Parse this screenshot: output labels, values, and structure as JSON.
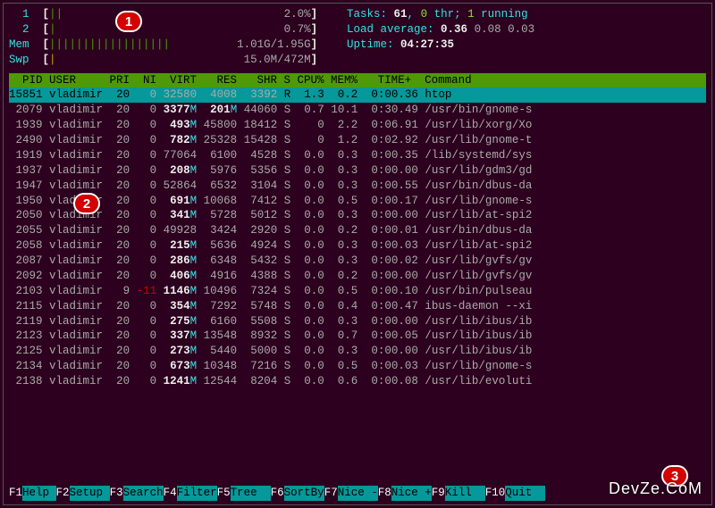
{
  "cpu_bars": [
    {
      "id": "1",
      "used": "||",
      "pct": "2.0%"
    },
    {
      "id": "2",
      "used": "|",
      "pct": "0.7%"
    }
  ],
  "mem": {
    "label": "Mem",
    "bars": "||||||||||||||||||",
    "text": "1.01G/1.95G"
  },
  "swp": {
    "label": "Swp",
    "bars": "|",
    "text": "15.0M/472M"
  },
  "tasks": {
    "label": "Tasks:",
    "total": "61",
    "thr": "0",
    "thr_suffix": "thr;",
    "running": "1",
    "running_suffix": "running"
  },
  "load": {
    "label": "Load average:",
    "v1": "0.36",
    "v2": "0.08",
    "v3": "0.03"
  },
  "uptime": {
    "label": "Uptime:",
    "value": "04:27:35"
  },
  "columns": "  PID USER     PRI  NI  VIRT   RES   SHR S CPU% MEM%   TIME+  Command           ",
  "processes": [
    {
      "pid": "15851",
      "user": "vladimir",
      "pri": "20",
      "ni": "0",
      "virt": "32580",
      "res": "4008",
      "shr": "3392",
      "s": "R",
      "cpu": "1.3",
      "mem": "0.2",
      "time": "0:00.36",
      "cmd": "htop",
      "hl": true
    },
    {
      "pid": "2079",
      "user": "vladimir",
      "pri": "20",
      "ni": "0",
      "virt": "3377M",
      "res": "201M",
      "shr": "44060",
      "s": "S",
      "cpu": "0.7",
      "mem": "10.1",
      "time": "0:30.49",
      "cmd": "/usr/bin/gnome-s"
    },
    {
      "pid": "1939",
      "user": "vladimir",
      "pri": "20",
      "ni": "0",
      "virt": "493M",
      "res": "45800",
      "shr": "18412",
      "s": "S",
      "cpu": "0",
      "mem": "2.2",
      "time": "0:06.91",
      "cmd": "/usr/lib/xorg/Xo"
    },
    {
      "pid": "2490",
      "user": "vladimir",
      "pri": "20",
      "ni": "0",
      "virt": "782M",
      "res": "25328",
      "shr": "15428",
      "s": "S",
      "cpu": "0",
      "mem": "1.2",
      "time": "0:02.92",
      "cmd": "/usr/lib/gnome-t"
    },
    {
      "pid": "1919",
      "user": "vladimir",
      "pri": "20",
      "ni": "0",
      "virt": "77064",
      "res": "6100",
      "shr": "4528",
      "s": "S",
      "cpu": "0.0",
      "mem": "0.3",
      "time": "0:00.35",
      "cmd": "/lib/systemd/sys"
    },
    {
      "pid": "1937",
      "user": "vladimir",
      "pri": "20",
      "ni": "0",
      "virt": "208M",
      "res": "5976",
      "shr": "5356",
      "s": "S",
      "cpu": "0.0",
      "mem": "0.3",
      "time": "0:00.00",
      "cmd": "/usr/lib/gdm3/gd"
    },
    {
      "pid": "1947",
      "user": "vladimir",
      "pri": "20",
      "ni": "0",
      "virt": "52864",
      "res": "6532",
      "shr": "3104",
      "s": "S",
      "cpu": "0.0",
      "mem": "0.3",
      "time": "0:00.55",
      "cmd": "/usr/bin/dbus-da"
    },
    {
      "pid": "1950",
      "user": "vladimir",
      "pri": "20",
      "ni": "0",
      "virt": "691M",
      "res": "10068",
      "shr": "7412",
      "s": "S",
      "cpu": "0.0",
      "mem": "0.5",
      "time": "0:00.17",
      "cmd": "/usr/lib/gnome-s"
    },
    {
      "pid": "2050",
      "user": "vladimir",
      "pri": "20",
      "ni": "0",
      "virt": "341M",
      "res": "5728",
      "shr": "5012",
      "s": "S",
      "cpu": "0.0",
      "mem": "0.3",
      "time": "0:00.00",
      "cmd": "/usr/lib/at-spi2"
    },
    {
      "pid": "2055",
      "user": "vladimir",
      "pri": "20",
      "ni": "0",
      "virt": "49928",
      "res": "3424",
      "shr": "2920",
      "s": "S",
      "cpu": "0.0",
      "mem": "0.2",
      "time": "0:00.01",
      "cmd": "/usr/bin/dbus-da"
    },
    {
      "pid": "2058",
      "user": "vladimir",
      "pri": "20",
      "ni": "0",
      "virt": "215M",
      "res": "5636",
      "shr": "4924",
      "s": "S",
      "cpu": "0.0",
      "mem": "0.3",
      "time": "0:00.03",
      "cmd": "/usr/lib/at-spi2"
    },
    {
      "pid": "2087",
      "user": "vladimir",
      "pri": "20",
      "ni": "0",
      "virt": "286M",
      "res": "6348",
      "shr": "5432",
      "s": "S",
      "cpu": "0.0",
      "mem": "0.3",
      "time": "0:00.02",
      "cmd": "/usr/lib/gvfs/gv"
    },
    {
      "pid": "2092",
      "user": "vladimir",
      "pri": "20",
      "ni": "0",
      "virt": "406M",
      "res": "4916",
      "shr": "4388",
      "s": "S",
      "cpu": "0.0",
      "mem": "0.2",
      "time": "0:00.00",
      "cmd": "/usr/lib/gvfs/gv"
    },
    {
      "pid": "2103",
      "user": "vladimir",
      "pri": "9",
      "ni": "-11",
      "virt": "1146M",
      "res": "10496",
      "shr": "7324",
      "s": "S",
      "cpu": "0.0",
      "mem": "0.5",
      "time": "0:00.10",
      "cmd": "/usr/bin/pulseau"
    },
    {
      "pid": "2115",
      "user": "vladimir",
      "pri": "20",
      "ni": "0",
      "virt": "354M",
      "res": "7292",
      "shr": "5748",
      "s": "S",
      "cpu": "0.0",
      "mem": "0.4",
      "time": "0:00.47",
      "cmd": "ibus-daemon --xi"
    },
    {
      "pid": "2119",
      "user": "vladimir",
      "pri": "20",
      "ni": "0",
      "virt": "275M",
      "res": "6160",
      "shr": "5508",
      "s": "S",
      "cpu": "0.0",
      "mem": "0.3",
      "time": "0:00.00",
      "cmd": "/usr/lib/ibus/ib"
    },
    {
      "pid": "2123",
      "user": "vladimir",
      "pri": "20",
      "ni": "0",
      "virt": "337M",
      "res": "13548",
      "shr": "8932",
      "s": "S",
      "cpu": "0.0",
      "mem": "0.7",
      "time": "0:00.05",
      "cmd": "/usr/lib/ibus/ib"
    },
    {
      "pid": "2125",
      "user": "vladimir",
      "pri": "20",
      "ni": "0",
      "virt": "273M",
      "res": "5440",
      "shr": "5000",
      "s": "S",
      "cpu": "0.0",
      "mem": "0.3",
      "time": "0:00.00",
      "cmd": "/usr/lib/ibus/ib"
    },
    {
      "pid": "2134",
      "user": "vladimir",
      "pri": "20",
      "ni": "0",
      "virt": "673M",
      "res": "10348",
      "shr": "7216",
      "s": "S",
      "cpu": "0.0",
      "mem": "0.5",
      "time": "0:00.03",
      "cmd": "/usr/lib/gnome-s"
    },
    {
      "pid": "2138",
      "user": "vladimir",
      "pri": "20",
      "ni": "0",
      "virt": "1241M",
      "res": "12544",
      "shr": "8204",
      "s": "S",
      "cpu": "0.0",
      "mem": "0.6",
      "time": "0:00.08",
      "cmd": "/usr/lib/evoluti"
    }
  ],
  "fnkeys": [
    {
      "key": "F1",
      "lbl": "Help "
    },
    {
      "key": "F2",
      "lbl": "Setup "
    },
    {
      "key": "F3",
      "lbl": "Search"
    },
    {
      "key": "F4",
      "lbl": "Filter"
    },
    {
      "key": "F5",
      "lbl": "Tree  "
    },
    {
      "key": "F6",
      "lbl": "SortBy"
    },
    {
      "key": "F7",
      "lbl": "Nice -"
    },
    {
      "key": "F8",
      "lbl": "Nice +"
    },
    {
      "key": "F9",
      "lbl": "Kill  "
    },
    {
      "key": "F10",
      "lbl": "Quit  "
    }
  ],
  "annotations": {
    "a1": "1",
    "a2": "2",
    "a3": "3"
  },
  "watermark": "DevZe.CoM"
}
